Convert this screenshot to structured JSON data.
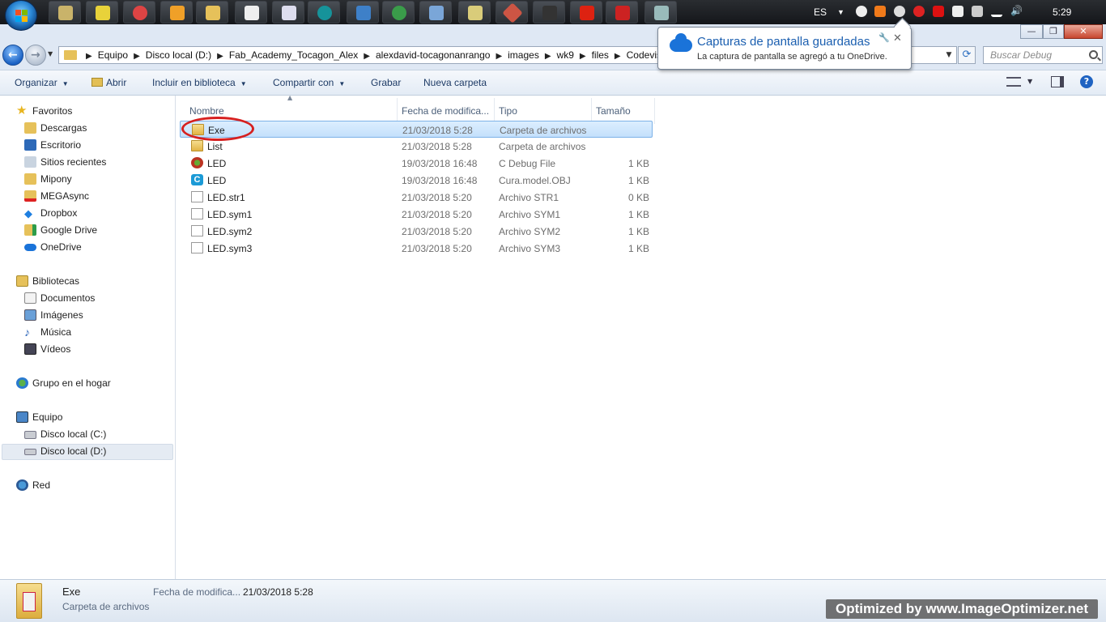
{
  "taskbar": {
    "language": "ES",
    "clock": "5:29",
    "accent": "#2a86d4"
  },
  "notification": {
    "title": "Capturas de pantalla guardadas",
    "body": "La captura de pantalla se agregó a tu OneDrive."
  },
  "address": {
    "crumbs": [
      "Equipo",
      "Disco local (D:)",
      "Fab_Academy_Tocagon_Alex",
      "alexdavid-tocagonanrango",
      "images",
      "wk9",
      "files",
      "Codevisio"
    ],
    "search_placeholder": "Buscar Debug"
  },
  "toolbar": {
    "organize": "Organizar",
    "open": "Abrir",
    "include": "Incluir en biblioteca",
    "share": "Compartir con",
    "burn": "Grabar",
    "new_folder": "Nueva carpeta"
  },
  "nav": {
    "favorites": "Favoritos",
    "downloads": "Descargas",
    "desktop": "Escritorio",
    "recent": "Sitios recientes",
    "mipony": "Mipony",
    "megasync": "MEGAsync",
    "dropbox": "Dropbox",
    "gdrive": "Google Drive",
    "onedrive": "OneDrive",
    "libraries": "Bibliotecas",
    "documents": "Documentos",
    "images": "Imágenes",
    "music": "Música",
    "videos": "Vídeos",
    "homegroup": "Grupo en el hogar",
    "computer": "Equipo",
    "disk_c": "Disco local (C:)",
    "disk_d": "Disco local (D:)",
    "network": "Red"
  },
  "columns": {
    "name": "Nombre",
    "date": "Fecha de modifica...",
    "type": "Tipo",
    "size": "Tamaño"
  },
  "files": [
    {
      "name": "Exe",
      "date": "21/03/2018 5:28",
      "type": "Carpeta de archivos",
      "size": "",
      "icon": "folder-icon"
    },
    {
      "name": "List",
      "date": "21/03/2018 5:28",
      "type": "Carpeta de archivos",
      "size": "",
      "icon": "folder-icon"
    },
    {
      "name": "LED",
      "date": "19/03/2018 16:48",
      "type": "C Debug File",
      "size": "1 KB",
      "icon": "debug-file-icon"
    },
    {
      "name": "LED",
      "date": "19/03/2018 16:48",
      "type": "Cura.model.OBJ",
      "size": "1 KB",
      "icon": "cura-model-icon"
    },
    {
      "name": "LED.str1",
      "date": "21/03/2018 5:20",
      "type": "Archivo STR1",
      "size": "0 KB",
      "icon": "file-icon"
    },
    {
      "name": "LED.sym1",
      "date": "21/03/2018 5:20",
      "type": "Archivo SYM1",
      "size": "1 KB",
      "icon": "file-icon"
    },
    {
      "name": "LED.sym2",
      "date": "21/03/2018 5:20",
      "type": "Archivo SYM2",
      "size": "1 KB",
      "icon": "file-icon"
    },
    {
      "name": "LED.sym3",
      "date": "21/03/2018 5:20",
      "type": "Archivo SYM3",
      "size": "1 KB",
      "icon": "file-icon"
    }
  ],
  "status": {
    "name": "Exe",
    "type": "Carpeta de archivos",
    "date_label": "Fecha de modifica...",
    "date_value": "21/03/2018 5:28"
  },
  "watermark": "Optimized by www.ImageOptimizer.net"
}
